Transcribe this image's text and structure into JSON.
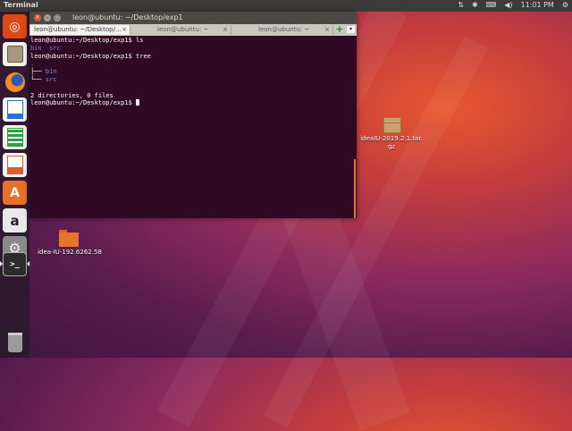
{
  "top_panel": {
    "app_title": "Terminal",
    "time": "11:01 PM",
    "tray_icons": [
      "network-updown-icon",
      "bluetooth-icon",
      "keyboard-layout-icon",
      "volume-icon",
      "settings-gear-icon"
    ]
  },
  "launcher": {
    "items": [
      {
        "name": "ubuntu-dash",
        "icon": "ubuntu-logo-icon",
        "color": "#dd4814"
      },
      {
        "name": "files",
        "icon": "file-cabinet-icon",
        "color": "#8a7a68"
      },
      {
        "name": "firefox",
        "icon": "firefox-icon",
        "color": "#e8742c"
      },
      {
        "name": "libreoffice-writer",
        "icon": "writer-icon",
        "color": "#2a6fd6"
      },
      {
        "name": "libreoffice-calc",
        "icon": "calc-icon",
        "color": "#2ea043"
      },
      {
        "name": "libreoffice-impress",
        "icon": "impress-icon",
        "color": "#e25b2a"
      },
      {
        "name": "software-center",
        "icon": "shopping-bag-icon",
        "color": "#e8702a"
      },
      {
        "name": "amazon",
        "icon": "amazon-icon",
        "color": "#e8e8e8"
      },
      {
        "name": "system-settings",
        "icon": "settings-gear-icon",
        "color": "#c0392b"
      },
      {
        "name": "terminal",
        "icon": "terminal-icon",
        "color": "#2c2c2c"
      },
      {
        "name": "trash",
        "icon": "trash-icon",
        "color": "#777777"
      }
    ]
  },
  "terminal": {
    "window_title": "leon@ubuntu: ~/Desktop/exp1",
    "tabs": [
      {
        "label": "leon@ubuntu: ~/Desktop/..."
      },
      {
        "label": "leon@ubuntu: ~"
      },
      {
        "label": "leon@ubuntu: ~"
      }
    ],
    "prompt": "leon@ubuntu:~/Desktop/exp1$",
    "lines": {
      "cmd1": " ls",
      "ls_bin": "bin",
      "ls_src": "src",
      "cmd2": " tree",
      "tree_root": ".",
      "tree_bin_branch": "├── ",
      "tree_bin": "bin",
      "tree_src_branch": "└── ",
      "tree_src": "src",
      "summary": "2 directories, 0 files"
    }
  },
  "desktop": {
    "icons": [
      {
        "label": "ideaIU-2019.2.1.tar.gz",
        "label_line1": "ideaIU-2019.2.1.tar.",
        "label_line2": "gz",
        "type": "archive"
      },
      {
        "label": "idea-IU-192.6262.58",
        "type": "folder"
      }
    ]
  },
  "colors": {
    "terminal_bg": "#300a24",
    "ubuntu_orange": "#e95420",
    "titlebar": "#4a4944"
  }
}
